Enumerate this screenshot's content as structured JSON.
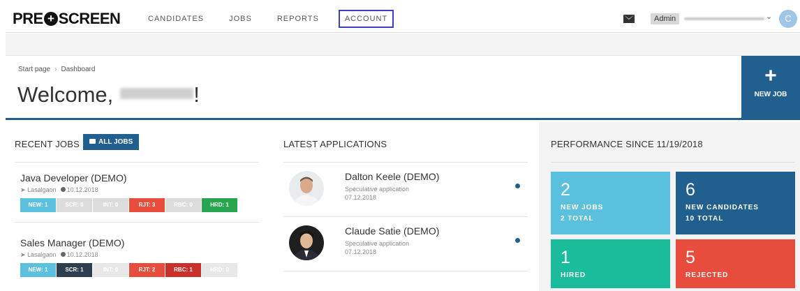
{
  "nav": {
    "logo_left": "PRE",
    "logo_right": "SCREEN",
    "items": [
      "CANDIDATES",
      "JOBS",
      "REPORTS",
      "ACCOUNT"
    ],
    "admin_label": "Admin",
    "avatar_letter": "C"
  },
  "header": {
    "breadcrumb": [
      "Start page",
      "Dashboard"
    ],
    "welcome_prefix": "Welcome,",
    "welcome_suffix": "!",
    "new_job_label": "NEW JOB"
  },
  "recent_jobs": {
    "title": "RECENT JOBS",
    "all_jobs_label": "ALL JOBS",
    "jobs": [
      {
        "title": "Java Developer (DEMO)",
        "location": "Lasalgaon",
        "date": "10.12.2018",
        "stages": [
          {
            "label": "NEW: 1",
            "color": "#5bc0de"
          },
          {
            "label": "SCR: 0",
            "color": "#dcdcdc"
          },
          {
            "label": "INT: 0",
            "color": "#dcdcdc"
          },
          {
            "label": "RJT: 3",
            "color": "#e74c3c"
          },
          {
            "label": "RBC: 0",
            "color": "#dcdcdc"
          },
          {
            "label": "HRD: 1",
            "color": "#27a54f"
          }
        ]
      },
      {
        "title": "Sales Manager (DEMO)",
        "location": "Lasalgaon",
        "date": "10.12.2018",
        "stages": [
          {
            "label": "NEW: 1",
            "color": "#5bc0de"
          },
          {
            "label": "SCR: 1",
            "color": "#2c3e50"
          },
          {
            "label": "INT: 0",
            "color": "#e8e8e8"
          },
          {
            "label": "RJT: 2",
            "color": "#e74c3c"
          },
          {
            "label": "RBC: 1",
            "color": "#c9302c"
          },
          {
            "label": "HRD: 0",
            "color": "#e8e8e8"
          }
        ]
      }
    ]
  },
  "applications": {
    "title": "LATEST APPLICATIONS",
    "items": [
      {
        "name": "Dalton Keele (DEMO)",
        "type": "Speculative application",
        "date": "07.12.2018"
      },
      {
        "name": "Claude Satie (DEMO)",
        "type": "Speculative application",
        "date": "07.12.2018"
      }
    ]
  },
  "performance": {
    "title": "PERFORMANCE SINCE 11/19/2018",
    "tiles": [
      {
        "num": "2",
        "l1": "NEW JOBS",
        "l2": "2 TOTAL",
        "color": "#5bc0de"
      },
      {
        "num": "6",
        "l1": "NEW CANDIDATES",
        "l2": "10 TOTAL",
        "color": "#215f8f"
      },
      {
        "num": "1",
        "l1": "HIRED",
        "l2": "",
        "color": "#1abc9c"
      },
      {
        "num": "5",
        "l1": "REJECTED",
        "l2": "",
        "color": "#e74c3c"
      }
    ]
  }
}
